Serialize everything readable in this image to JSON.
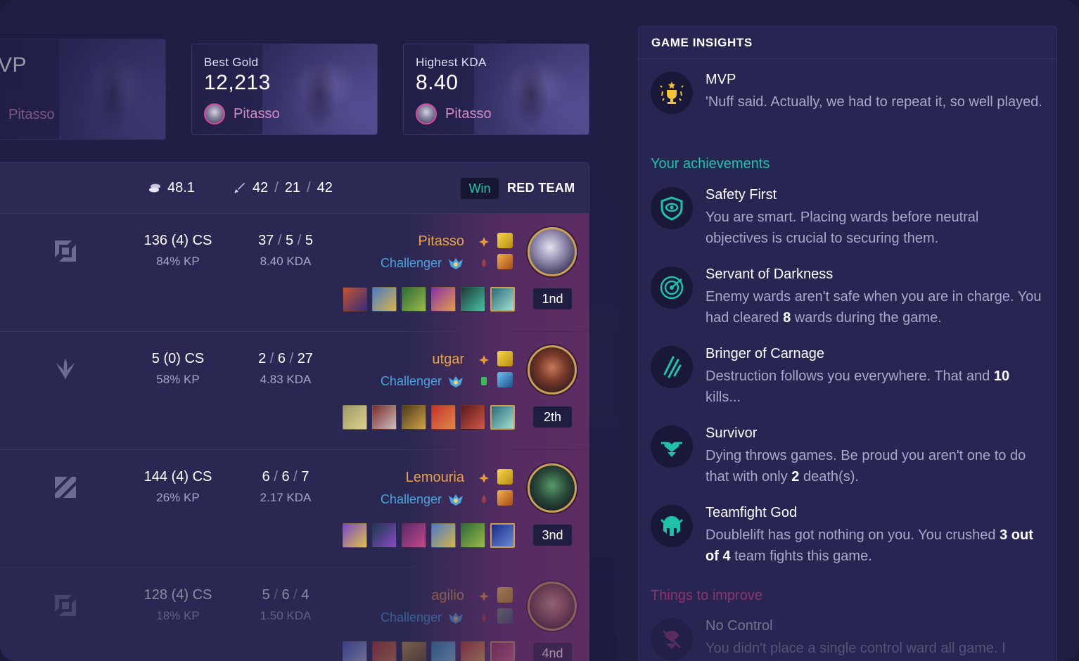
{
  "top_cards": [
    {
      "label": "",
      "value": "VP",
      "player": "Pitasso"
    },
    {
      "label": "Best Gold",
      "value": "12,213",
      "player": "Pitasso"
    },
    {
      "label": "Highest KDA",
      "value": "8.40",
      "player": "Pitasso"
    }
  ],
  "summary": {
    "gold": "48.1",
    "kills": "42",
    "deaths": "21",
    "assists": "42",
    "result": "Win",
    "team": "RED TEAM"
  },
  "players": [
    {
      "role_icon": "top-role-icon",
      "cs": "136 (4) CS",
      "kp": "84% KP",
      "k": "37",
      "d": "5",
      "a": "5",
      "kda": "8.40 KDA",
      "name": "Pitasso",
      "rank": "Challenger",
      "place": "1nd"
    },
    {
      "role_icon": "jungle-role-icon",
      "cs": "5 (0) CS",
      "kp": "58% KP",
      "k": "2",
      "d": "6",
      "a": "27",
      "kda": "4.83 KDA",
      "name": "utgar",
      "rank": "Challenger",
      "place": "2th"
    },
    {
      "role_icon": "mid-role-icon",
      "cs": "144 (4) CS",
      "kp": "26% KP",
      "k": "6",
      "d": "6",
      "a": "7",
      "kda": "2.17 KDA",
      "name": "Lemouria",
      "rank": "Challenger",
      "place": "3nd"
    },
    {
      "role_icon": "top-role-icon",
      "cs": "128 (4) CS",
      "kp": "18% KP",
      "k": "5",
      "d": "6",
      "a": "4",
      "kda": "1.50 KDA",
      "name": "agilio",
      "rank": "Challenger",
      "place": "4nd"
    }
  ],
  "insights": {
    "header": "GAME INSIGHTS",
    "mvp": {
      "title": "MVP",
      "desc": "'Nuff said. Actually, we had to repeat it, so well played."
    },
    "achievements_title": "Your achievements",
    "achievements": [
      {
        "icon": "ward-eye-icon",
        "title": "Safety First",
        "desc": "You are smart. Placing wards before neutral objectives is crucial to securing them."
      },
      {
        "icon": "radar-icon",
        "title": "Servant of Darkness",
        "desc_pre": "Enemy wards aren't safe when you are in charge. You had cleared ",
        "desc_num": "8",
        "desc_post": " wards during the game."
      },
      {
        "icon": "claw-marks-icon",
        "title": "Bringer of Carnage",
        "desc_pre": "Destruction follows you everywhere. That and ",
        "desc_num": "10",
        "desc_post": " kills..."
      },
      {
        "icon": "heart-person-icon",
        "title": "Survivor",
        "desc_pre": "Dying throws games. Be proud you aren't one to do that with only ",
        "desc_num": "2",
        "desc_post": " death(s)."
      },
      {
        "icon": "helmet-icon",
        "title": "Teamfight God",
        "desc_pre": "Doublelift has got nothing on you. You crushed ",
        "desc_num": "3",
        "desc_mid": " out of ",
        "desc_num2": "4",
        "desc_post": " team fights this game."
      }
    ],
    "improve_title": "Things to improve",
    "improve": [
      {
        "icon": "no-ward-icon",
        "title": "No Control",
        "desc": "You didn't place a single control ward all game. I"
      }
    ]
  },
  "colors": {
    "accent_teal": "#1fc2a9",
    "gold_name": "#e7a24a",
    "rank_blue": "#4aa4e0",
    "improve_pink": "#b23a7d"
  }
}
